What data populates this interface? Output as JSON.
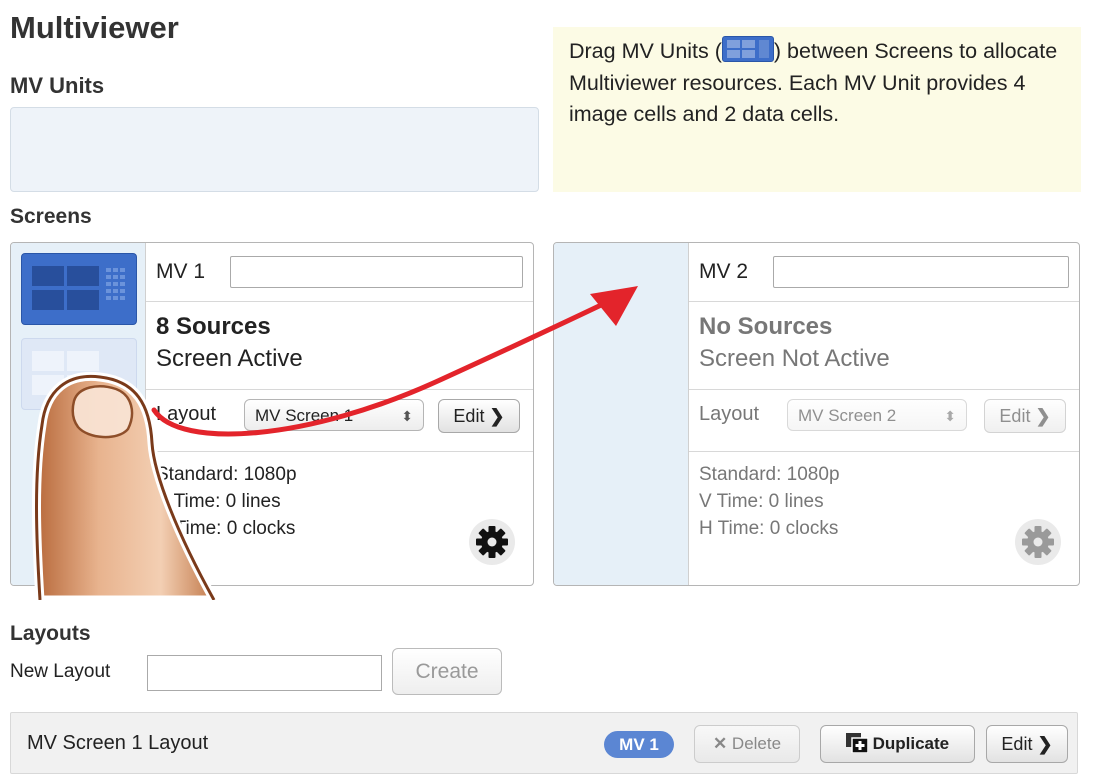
{
  "page": {
    "title": "Multiviewer",
    "mv_units_heading": "MV Units",
    "screens_heading": "Screens",
    "layouts_heading": "Layouts"
  },
  "tip": {
    "text_before_icon": "Drag MV Units (",
    "text_after_icon": ") between Screens to allocate Multiviewer resources. Each MV Unit provides 4 image cells and 2 data cells."
  },
  "screens": [
    {
      "label": "MV 1",
      "name_value": "",
      "sources": "8 Sources",
      "status": "Screen Active",
      "layout_label": "Layout",
      "layout_selected": "MV Screen 1",
      "edit_label": "Edit",
      "standard": "Standard: 1080p",
      "v_time": "V Time: 0 lines",
      "h_time": "H Time: 0 clocks"
    },
    {
      "label": "MV 2",
      "name_value": "",
      "sources": "No Sources",
      "status": "Screen Not Active",
      "layout_label": "Layout",
      "layout_selected": "MV Screen 2",
      "edit_label": "Edit",
      "standard": "Standard: 1080p",
      "v_time": "V Time: 0 lines",
      "h_time": "H Time: 0 clocks"
    }
  ],
  "layouts": {
    "new_layout_label": "New Layout",
    "new_layout_value": "",
    "create_label": "Create",
    "rows": [
      {
        "name": "MV Screen 1 Layout",
        "badge": "MV 1",
        "delete_label": "Delete",
        "duplicate_label": "Duplicate",
        "edit_label": "Edit"
      }
    ]
  },
  "colors": {
    "mv_unit_blue": "#3d6ec9",
    "badge_blue": "#5b86d3",
    "tip_background": "#fcfbe5",
    "arrow_red": "#e3242b",
    "slot_background": "#e6f0f8"
  },
  "icons": [
    "mv-unit-icon",
    "gear-icon",
    "chevron-right-icon",
    "close-icon",
    "duplicate-icon",
    "hand-pointer-icon",
    "drag-arrow-icon"
  ]
}
